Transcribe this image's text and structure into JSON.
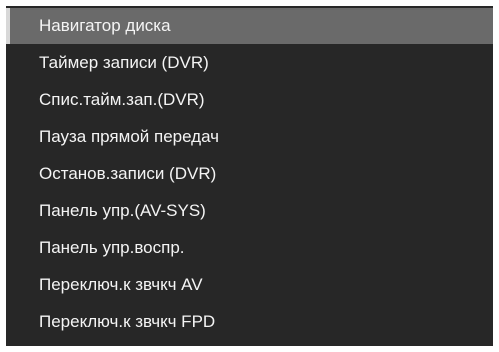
{
  "menu": {
    "items": [
      {
        "label": "Навигатор диска",
        "selected": true
      },
      {
        "label": "Таймер записи (DVR)",
        "selected": false
      },
      {
        "label": "Спис.тайм.зап.(DVR)",
        "selected": false
      },
      {
        "label": "Пауза прямой передач",
        "selected": false
      },
      {
        "label": "Останов.записи (DVR)",
        "selected": false
      },
      {
        "label": "Панель упр.(AV-SYS)",
        "selected": false
      },
      {
        "label": "Панель упр.воспр.",
        "selected": false
      },
      {
        "label": "Переключ.к звчкч AV",
        "selected": false
      },
      {
        "label": "Переключ.к звчкч FPD",
        "selected": false
      }
    ]
  },
  "colors": {
    "background": "#272727",
    "selected_background": "#6a6a6a",
    "text": "#f4f4f4"
  }
}
